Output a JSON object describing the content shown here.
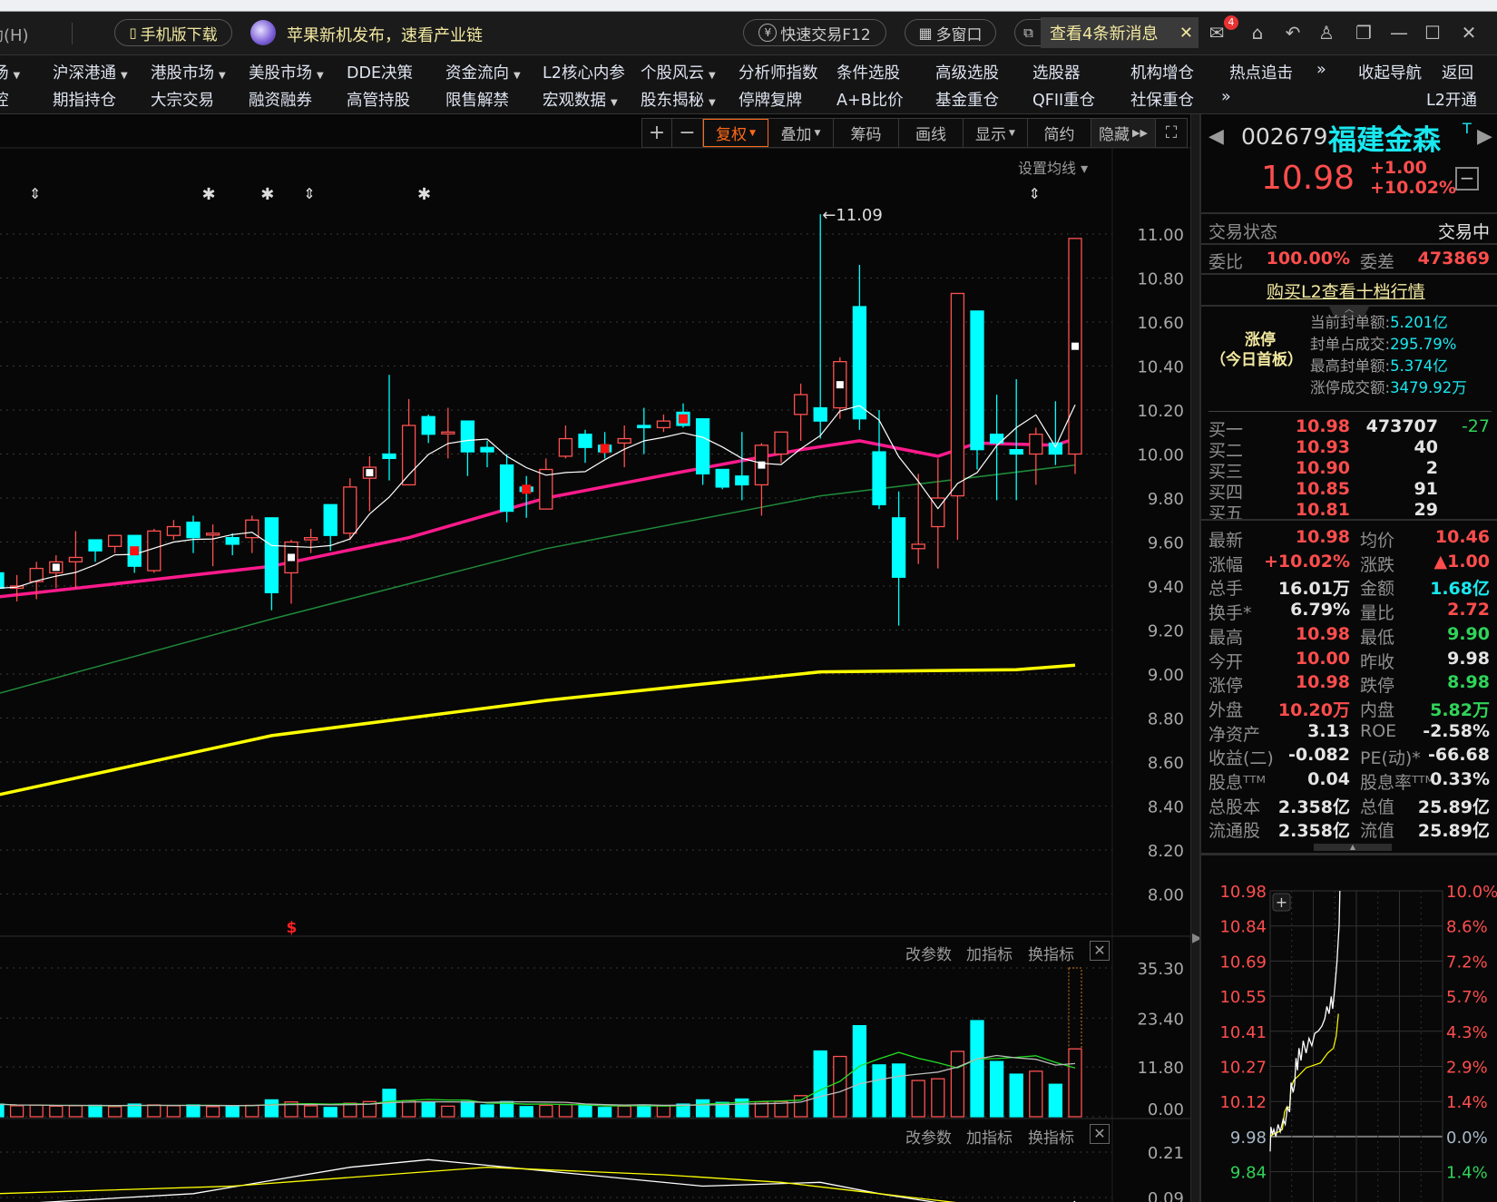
{
  "titlebar": {
    "menu_fragment": "助(H)",
    "mobile_download": "手机版下载",
    "news_text": "苹果新机发布，速看产业链",
    "quick_trade": "快速交易F12",
    "multi_window": "多窗口",
    "messages": "查看4条新消息",
    "message_badge": "4"
  },
  "nav": {
    "row1": [
      {
        "label": "场",
        "dropdown": true
      },
      {
        "label": "沪深港通",
        "dropdown": true
      },
      {
        "label": "港股市场",
        "dropdown": true
      },
      {
        "label": "美股市场",
        "dropdown": true
      },
      {
        "label": "DDE决策",
        "dropdown": false
      },
      {
        "label": "资金流向",
        "dropdown": true
      },
      {
        "label": "L2核心内参",
        "dropdown": false
      },
      {
        "label": "个股风云",
        "dropdown": true
      },
      {
        "label": "分析师指数",
        "dropdown": false
      },
      {
        "label": "条件选股",
        "dropdown": false
      },
      {
        "label": "高级选股",
        "dropdown": false
      },
      {
        "label": "选股器",
        "dropdown": false
      },
      {
        "label": "机构增仓",
        "dropdown": false
      },
      {
        "label": "热点追击",
        "dropdown": false
      },
      {
        "label": "»",
        "dropdown": false
      },
      {
        "label": "收起导航",
        "dropdown": false
      },
      {
        "label": "返回",
        "dropdown": false
      }
    ],
    "row2": [
      {
        "label": "控",
        "dropdown": false
      },
      {
        "label": "期指持仓",
        "dropdown": false
      },
      {
        "label": "大宗交易",
        "dropdown": false
      },
      {
        "label": "融资融券",
        "dropdown": false
      },
      {
        "label": "高管持股",
        "dropdown": false
      },
      {
        "label": "限售解禁",
        "dropdown": false
      },
      {
        "label": "宏观数据",
        "dropdown": true
      },
      {
        "label": "股东揭秘",
        "dropdown": true
      },
      {
        "label": "停牌复牌",
        "dropdown": false
      },
      {
        "label": "A+B比价",
        "dropdown": false
      },
      {
        "label": "基金重仓",
        "dropdown": false
      },
      {
        "label": "QFII重仓",
        "dropdown": false
      },
      {
        "label": "社保重仓",
        "dropdown": false
      },
      {
        "label": "»",
        "dropdown": false
      },
      {
        "label": "L2开通",
        "dropdown": false
      }
    ]
  },
  "toolbar": {
    "plus": "+",
    "minus": "−",
    "fuquan": "复权",
    "overlay": "叠加",
    "chips": "筹码",
    "draw": "画线",
    "display": "显示",
    "simple": "简约",
    "hide": "隐藏"
  },
  "chart_header": {
    "set_ma": "设置均线 ▾",
    "peak_label": "←11.09"
  },
  "indicator_header": {
    "edit_params": "改参数",
    "add_indicator": "加指标",
    "switch_indicator": "换指标"
  },
  "colors": {
    "up": "#ff5050",
    "down": "#00ffff",
    "ma5": "#ffffff",
    "ma_mid": "#ff1a8c",
    "ma_long": "#1f8a3a",
    "ma_year": "#ffff00",
    "bg": "#070707"
  },
  "chart_data": [
    {
      "type": "candlestick",
      "title": "002679 福建金森 日K",
      "ylim": [
        8.0,
        11.0
      ],
      "yticks": [
        "11.00",
        "10.80",
        "10.60",
        "10.40",
        "10.20",
        "10.00",
        "9.80",
        "9.60",
        "9.40",
        "9.20",
        "9.00",
        "8.80",
        "8.60",
        "8.40",
        "8.20",
        "8.00"
      ],
      "peak": {
        "index": 42,
        "value": 11.09
      },
      "ohlc": [
        [
          9.46,
          9.46,
          9.39,
          9.39
        ],
        [
          9.39,
          9.45,
          9.33,
          9.4
        ],
        [
          9.42,
          9.51,
          9.34,
          9.48
        ],
        [
          9.46,
          9.54,
          9.39,
          9.51
        ],
        [
          9.51,
          9.65,
          9.39,
          9.53
        ],
        [
          9.61,
          9.61,
          9.51,
          9.56
        ],
        [
          9.58,
          9.63,
          9.55,
          9.63
        ],
        [
          9.63,
          9.63,
          9.46,
          9.49
        ],
        [
          9.47,
          9.66,
          9.46,
          9.65
        ],
        [
          9.63,
          9.7,
          9.61,
          9.67
        ],
        [
          9.69,
          9.72,
          9.55,
          9.62
        ],
        [
          9.64,
          9.68,
          9.49,
          9.64
        ],
        [
          9.62,
          9.64,
          9.54,
          9.59
        ],
        [
          9.62,
          9.72,
          9.55,
          9.7
        ],
        [
          9.71,
          9.71,
          9.29,
          9.37
        ],
        [
          9.46,
          9.61,
          9.32,
          9.6
        ],
        [
          9.61,
          9.66,
          9.55,
          9.62
        ],
        [
          9.77,
          9.77,
          9.56,
          9.63
        ],
        [
          9.64,
          9.89,
          9.61,
          9.85
        ],
        [
          9.89,
          9.99,
          9.74,
          9.94
        ],
        [
          10.0,
          10.36,
          9.88,
          9.98
        ],
        [
          9.86,
          10.25,
          9.86,
          10.13
        ],
        [
          10.17,
          10.18,
          10.05,
          10.09
        ],
        [
          10.1,
          10.21,
          9.98,
          10.1
        ],
        [
          10.15,
          10.15,
          9.9,
          10.01
        ],
        [
          10.03,
          10.06,
          9.94,
          10.01
        ],
        [
          9.95,
          10.0,
          9.69,
          9.74
        ],
        [
          9.85,
          9.9,
          9.71,
          9.83
        ],
        [
          9.75,
          9.98,
          9.75,
          9.93
        ],
        [
          9.99,
          10.13,
          9.98,
          10.07
        ],
        [
          10.09,
          10.11,
          9.96,
          10.03
        ],
        [
          10.04,
          10.1,
          9.98,
          10.01
        ],
        [
          10.05,
          10.13,
          9.94,
          10.07
        ],
        [
          10.13,
          10.21,
          10.0,
          10.12
        ],
        [
          10.12,
          10.18,
          10.1,
          10.15
        ],
        [
          10.19,
          10.23,
          10.12,
          10.13
        ],
        [
          10.16,
          10.16,
          9.86,
          9.91
        ],
        [
          9.93,
          9.93,
          9.84,
          9.85
        ],
        [
          9.9,
          10.1,
          9.79,
          9.86
        ],
        [
          9.86,
          10.05,
          9.72,
          10.04
        ],
        [
          10.0,
          10.1,
          9.96,
          10.1
        ],
        [
          10.18,
          10.32,
          10.06,
          10.27
        ],
        [
          10.21,
          11.09,
          10.07,
          10.15
        ],
        [
          10.21,
          10.44,
          10.16,
          10.42
        ],
        [
          10.67,
          10.86,
          10.11,
          10.16
        ],
        [
          10.01,
          10.2,
          9.75,
          9.77
        ],
        [
          9.71,
          9.83,
          9.22,
          9.44
        ],
        [
          9.57,
          9.91,
          9.5,
          9.59
        ],
        [
          9.67,
          9.98,
          9.48,
          9.8
        ],
        [
          9.81,
          10.73,
          9.61,
          10.73
        ],
        [
          10.65,
          10.65,
          9.93,
          10.02
        ],
        [
          10.09,
          10.27,
          9.79,
          10.05
        ],
        [
          10.02,
          10.34,
          9.79,
          10.0
        ],
        [
          10.0,
          10.12,
          9.86,
          10.09
        ],
        [
          10.05,
          10.24,
          9.95,
          10.0
        ],
        [
          10.0,
          10.98,
          9.91,
          10.98
        ]
      ],
      "white_markers": [
        3,
        15,
        19,
        39,
        43,
        55
      ],
      "red_markers": [
        7,
        27,
        31,
        35
      ],
      "top_markers": {
        "arrows": [
          1,
          15,
          52
        ],
        "stars": [
          10,
          13,
          21
        ]
      },
      "dollar_marker_index": 14,
      "ma_mid": [
        [
          0,
          9.35
        ],
        [
          7,
          9.42
        ],
        [
          14,
          9.49
        ],
        [
          21,
          9.62
        ],
        [
          28,
          9.8
        ],
        [
          35,
          9.92
        ],
        [
          41,
          10.02
        ],
        [
          44,
          10.06
        ],
        [
          48,
          9.99
        ],
        [
          50,
          10.05
        ],
        [
          54,
          10.04
        ],
        [
          55,
          10.07
        ]
      ],
      "ma_long": [
        [
          0,
          8.91
        ],
        [
          14,
          9.25
        ],
        [
          28,
          9.57
        ],
        [
          42,
          9.81
        ],
        [
          55,
          9.95
        ]
      ],
      "ma_year": [
        [
          0,
          8.45
        ],
        [
          14,
          8.72
        ],
        [
          28,
          8.88
        ],
        [
          42,
          9.01
        ],
        [
          52,
          9.02
        ],
        [
          55,
          9.04
        ]
      ]
    },
    {
      "type": "bar",
      "title": "成交量",
      "ylim": [
        0,
        35.3
      ],
      "yticks": [
        "35.30",
        "23.40",
        "11.80",
        "0.00"
      ],
      "values": [
        3.0,
        2.6,
        2.7,
        2.5,
        2.6,
        2.7,
        2.4,
        3.0,
        2.8,
        2.6,
        2.8,
        2.4,
        2.6,
        2.7,
        4.0,
        3.5,
        2.6,
        2.2,
        3.2,
        3.6,
        6.5,
        3.8,
        3.4,
        2.5,
        3.6,
        2.8,
        3.6,
        2.4,
        2.7,
        2.9,
        2.6,
        2.2,
        2.5,
        2.8,
        2.6,
        3.0,
        4.0,
        3.4,
        4.2,
        3.5,
        3.6,
        5.0,
        15.6,
        14.3,
        21.6,
        12.3,
        12.5,
        8.6,
        9.0,
        15.5,
        22.8,
        13.1,
        10.1,
        10.8,
        7.7,
        16.1
      ],
      "projected_last": 35.3
    },
    {
      "type": "line",
      "title": "指标",
      "yticks": [
        "0.21",
        "0.09"
      ],
      "series": [
        {
          "name": "white",
          "points": [
            [
              0,
              0.07
            ],
            [
              10,
              0.1
            ],
            [
              18,
              0.17
            ],
            [
              22,
              0.19
            ],
            [
              28,
              0.16
            ],
            [
              36,
              0.12
            ],
            [
              42,
              0.13
            ],
            [
              45,
              0.1
            ],
            [
              50,
              0.06
            ],
            [
              54,
              0.04
            ],
            [
              55,
              0.08
            ]
          ]
        },
        {
          "name": "yellow",
          "points": [
            [
              0,
              0.1
            ],
            [
              12,
              0.12
            ],
            [
              25,
              0.17
            ],
            [
              34,
              0.15
            ],
            [
              40,
              0.13
            ],
            [
              45,
              0.1
            ],
            [
              50,
              0.07
            ],
            [
              55,
              0.05
            ]
          ]
        }
      ]
    },
    {
      "type": "line",
      "title": "分时",
      "prev_close": 9.98,
      "ylim": [
        9.7,
        10.98
      ],
      "left_ticks": [
        "10.98",
        "10.84",
        "10.69",
        "10.55",
        "10.41",
        "10.27",
        "10.12",
        "9.98",
        "9.84"
      ],
      "right_ticks": [
        "10.0%",
        "8.6%",
        "7.2%",
        "5.7%",
        "4.3%",
        "2.9%",
        "1.4%",
        "0.0%",
        "1.4%"
      ],
      "minutes_total": 240,
      "price": [
        [
          0,
          9.92
        ],
        [
          1,
          10.02
        ],
        [
          3,
          9.99
        ],
        [
          5,
          10.01
        ],
        [
          8,
          9.98
        ],
        [
          11,
          10.03
        ],
        [
          14,
          10.0
        ],
        [
          18,
          10.05
        ],
        [
          21,
          10.03
        ],
        [
          24,
          10.1
        ],
        [
          27,
          10.08
        ],
        [
          29,
          10.2
        ],
        [
          32,
          10.16
        ],
        [
          34,
          10.19
        ],
        [
          36,
          10.3
        ],
        [
          38,
          10.25
        ],
        [
          40,
          10.34
        ],
        [
          43,
          10.29
        ],
        [
          46,
          10.37
        ],
        [
          50,
          10.32
        ],
        [
          54,
          10.38
        ],
        [
          58,
          10.35
        ],
        [
          62,
          10.4
        ],
        [
          67,
          10.41
        ],
        [
          72,
          10.43
        ],
        [
          76,
          10.46
        ],
        [
          79,
          10.51
        ],
        [
          82,
          10.48
        ],
        [
          85,
          10.55
        ],
        [
          87,
          10.5
        ],
        [
          90,
          10.59
        ],
        [
          93,
          10.69
        ],
        [
          96,
          10.84
        ],
        [
          97,
          10.98
        ]
      ],
      "avg": [
        [
          0,
          9.98
        ],
        [
          4,
          9.99
        ],
        [
          12,
          10.0
        ],
        [
          17,
          10.01
        ],
        [
          20,
          10.08
        ],
        [
          23,
          10.1
        ],
        [
          27,
          10.1
        ],
        [
          29,
          10.18
        ],
        [
          33,
          10.21
        ],
        [
          40,
          10.23
        ],
        [
          50,
          10.26
        ],
        [
          70,
          10.28
        ],
        [
          80,
          10.32
        ],
        [
          88,
          10.34
        ],
        [
          92,
          10.39
        ],
        [
          95,
          10.48
        ]
      ]
    }
  ],
  "quote": {
    "code": "002679",
    "name": "福建金森",
    "t_badge": "T",
    "price": "10.98",
    "change": "+1.00",
    "change_pct": "+10.02%",
    "status_label": "交易状态",
    "status_value": "交易中",
    "weibi_label": "委比",
    "weibi_value": "100.00%",
    "weicha_label": "委差",
    "weicha_value": "473869",
    "l2_link": "购买L2查看十档行情",
    "limit_title": "涨停",
    "limit_sub": "（今日首板）",
    "limit_lines": [
      {
        "label": "当前封单额:",
        "value": "5.201亿"
      },
      {
        "label": "封单占成交:",
        "value": "295.79%"
      },
      {
        "label": "最高封单额:",
        "value": "5.374亿"
      },
      {
        "label": "涨停成交额:",
        "value": "3479.92万"
      }
    ],
    "bids": [
      {
        "label": "买一",
        "price": "10.98",
        "vol": "473707",
        "chg": "-27"
      },
      {
        "label": "买二",
        "price": "10.93",
        "vol": "40",
        "chg": ""
      },
      {
        "label": "买三",
        "price": "10.90",
        "vol": "2",
        "chg": ""
      },
      {
        "label": "买四",
        "price": "10.85",
        "vol": "91",
        "chg": ""
      },
      {
        "label": "买五",
        "price": "10.81",
        "vol": "29",
        "chg": ""
      }
    ],
    "stats": [
      {
        "l1": "最新",
        "v1": "10.98",
        "c1": "red",
        "l2": "均价",
        "v2": "10.46",
        "c2": "red"
      },
      {
        "l1": "涨幅",
        "v1": "+10.02%",
        "c1": "red",
        "l2": "涨跌",
        "v2": "▲1.00",
        "c2": "red"
      },
      {
        "l1": "总手",
        "v1": "16.01万",
        "c1": "white",
        "l2": "金额",
        "v2": "1.68亿",
        "c2": "cyan"
      },
      {
        "l1": "换手*",
        "v1": "6.79%",
        "c1": "white",
        "l2": "量比",
        "v2": "2.72",
        "c2": "red"
      },
      {
        "l1": "最高",
        "v1": "10.98",
        "c1": "red",
        "l2": "最低",
        "v2": "9.90",
        "c2": "green"
      },
      {
        "l1": "今开",
        "v1": "10.00",
        "c1": "red",
        "l2": "昨收",
        "v2": "9.98",
        "c2": "white"
      },
      {
        "l1": "涨停",
        "v1": "10.98",
        "c1": "red",
        "l2": "跌停",
        "v2": "8.98",
        "c2": "green"
      },
      {
        "l1": "外盘",
        "v1": "10.20万",
        "c1": "red",
        "l2": "内盘",
        "v2": "5.82万",
        "c2": "green"
      },
      {
        "l1": "净资产",
        "v1": "3.13",
        "c1": "white",
        "l2": "ROE",
        "v2": "-2.58%",
        "c2": "white"
      },
      {
        "l1": "收益(二)",
        "v1": "-0.082",
        "c1": "white",
        "l2": "PE(动)*",
        "v2": "-66.68",
        "c2": "white"
      },
      {
        "l1": "股息ᵀᵀᴹ",
        "v1": "0.04",
        "c1": "white",
        "l2": "股息率ᵀᵀᴹ",
        "v2": "0.33%",
        "c2": "white"
      },
      {
        "l1": "总股本",
        "v1": "2.358亿",
        "c1": "white",
        "l2": "总值",
        "v2": "25.89亿",
        "c2": "white"
      },
      {
        "l1": "流通股",
        "v1": "2.358亿",
        "c1": "white",
        "l2": "流值",
        "v2": "25.89亿",
        "c2": "white"
      }
    ]
  }
}
